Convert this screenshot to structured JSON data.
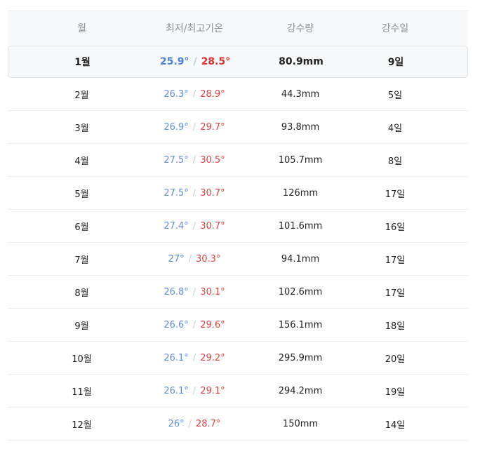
{
  "table": {
    "headers": {
      "month": "월",
      "temp": "최저/최고기온",
      "rain": "강수량",
      "days": "강수일"
    },
    "separator": "/",
    "rows": [
      {
        "month": "1월",
        "min": "25.9°",
        "max": "28.5°",
        "rain": "80.9mm",
        "days": "9일"
      },
      {
        "month": "2월",
        "min": "26.3°",
        "max": "28.9°",
        "rain": "44.3mm",
        "days": "5일"
      },
      {
        "month": "3월",
        "min": "26.9°",
        "max": "29.7°",
        "rain": "93.8mm",
        "days": "4일"
      },
      {
        "month": "4월",
        "min": "27.5°",
        "max": "30.5°",
        "rain": "105.7mm",
        "days": "8일"
      },
      {
        "month": "5월",
        "min": "27.5°",
        "max": "30.7°",
        "rain": "126mm",
        "days": "17일"
      },
      {
        "month": "6월",
        "min": "27.4°",
        "max": "30.7°",
        "rain": "101.6mm",
        "days": "16일"
      },
      {
        "month": "7월",
        "min": "27°",
        "max": "30.3°",
        "rain": "94.1mm",
        "days": "17일"
      },
      {
        "month": "8월",
        "min": "26.8°",
        "max": "30.1°",
        "rain": "102.6mm",
        "days": "17일"
      },
      {
        "month": "9월",
        "min": "26.6°",
        "max": "29.6°",
        "rain": "156.1mm",
        "days": "18일"
      },
      {
        "month": "10월",
        "min": "26.1°",
        "max": "29.2°",
        "rain": "295.9mm",
        "days": "20일"
      },
      {
        "month": "11월",
        "min": "26.1°",
        "max": "29.1°",
        "rain": "294.2mm",
        "days": "19일"
      },
      {
        "month": "12월",
        "min": "26°",
        "max": "28.7°",
        "rain": "150mm",
        "days": "14일"
      }
    ],
    "highlighted_row": 0,
    "colors": {
      "min_temp": "#5b8fe0",
      "max_temp": "#e2413f",
      "header_bg": "#f8f9fb",
      "highlight_bg": "#f7f9fa"
    }
  }
}
